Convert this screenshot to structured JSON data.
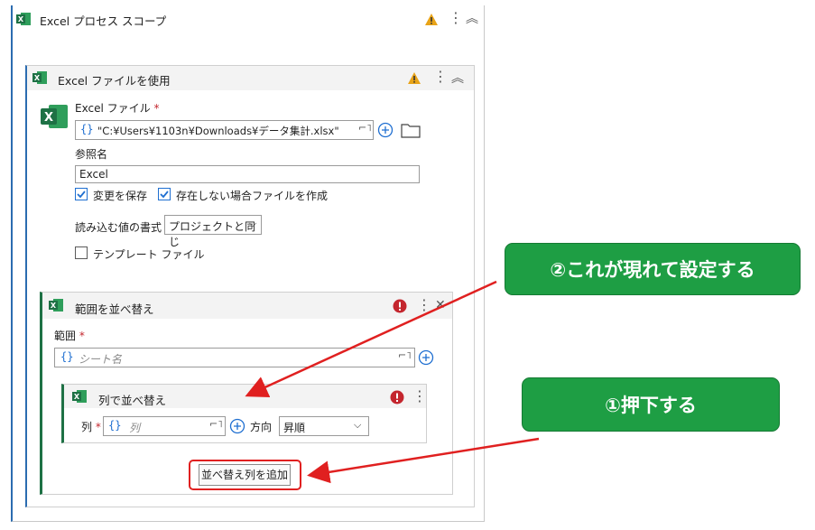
{
  "scope": {
    "title": "Excel プロセス スコープ"
  },
  "use_file": {
    "title": "Excel ファイルを使用",
    "file_label": "Excel ファイル",
    "required_mark": "*",
    "file_path": "\"C:¥Users¥1103n¥Downloads¥データ集計.xlsx\"",
    "ref_label": "参照名",
    "ref_value": "Excel",
    "save_changes": "変更を保存",
    "create_if_missing": "存在しない場合ファイルを作成",
    "read_format_label": "読み込む値の書式",
    "read_format_value": "プロジェクトと同じ",
    "template_label": "テンプレート ファイル"
  },
  "sort_range": {
    "title": "範囲を並べ替え",
    "range_label": "範囲",
    "range_placeholder": "シート名",
    "column_card": {
      "title": "列で並べ替え",
      "column_label": "列",
      "column_placeholder": "列",
      "direction_label": "方向",
      "direction_value": "昇順"
    },
    "add_column_button": "並べ替え列を追加"
  },
  "annotations": {
    "callout_1": "①押下する",
    "callout_2": "②これが現れて設定する"
  },
  "colors": {
    "excel_green": "#1e7145",
    "warning": "#e8a317",
    "error": "#c4262e",
    "callout_bg": "#1e9e44",
    "highlight_red": "#e02020",
    "accent_blue": "#1f6fd1"
  }
}
